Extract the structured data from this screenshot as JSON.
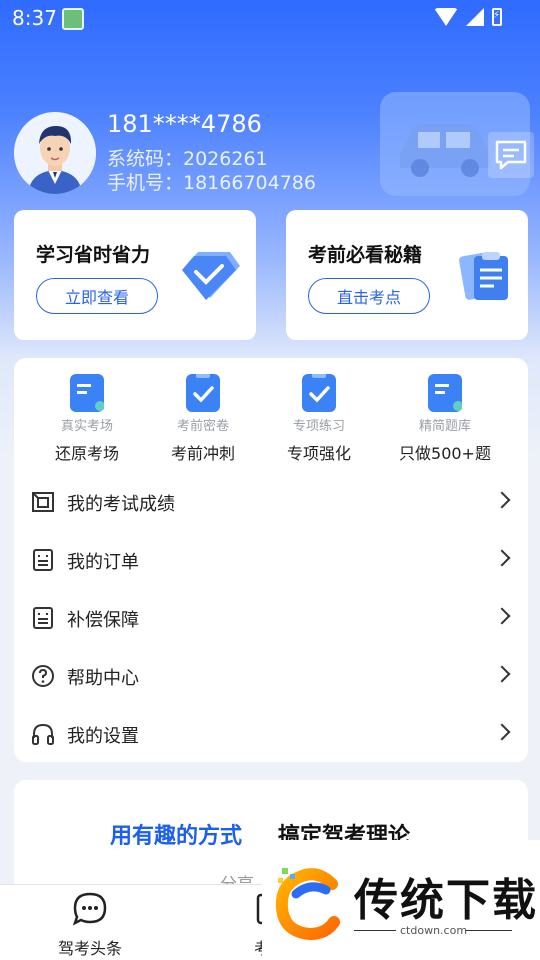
{
  "status": {
    "time": "8:37"
  },
  "profile": {
    "name": "181****4786",
    "system_code": "系统码：2026261",
    "phone": "手机号：18166704786"
  },
  "promo": [
    {
      "title": "学习省时省力",
      "button": "立即查看"
    },
    {
      "title": "考前必看秘籍",
      "button": "直击考点"
    }
  ],
  "features": [
    {
      "sub": "真实考场",
      "label": "还原考场",
      "icon": "doc-icon"
    },
    {
      "sub": "考前密卷",
      "label": "考前冲刺",
      "icon": "clipboard-check-icon"
    },
    {
      "sub": "专项练习",
      "label": "专项强化",
      "icon": "clipboard-check-icon"
    },
    {
      "sub": "精简题库",
      "label": "只做500+题",
      "icon": "doc-icon"
    }
  ],
  "menu": [
    {
      "label": "我的考试成绩",
      "icon": "score-icon"
    },
    {
      "label": "我的订单",
      "icon": "order-icon"
    },
    {
      "label": "补偿保障",
      "icon": "guarantee-icon"
    },
    {
      "label": "帮助中心",
      "icon": "help-icon"
    },
    {
      "label": "我的设置",
      "icon": "headset-icon"
    }
  ],
  "bottom_card": {
    "slogan_highlight": "用有趣的方式",
    "slogan_rest": "搞定驾考理论",
    "partial_text": "分享"
  },
  "tabs": [
    {
      "label": "驾考头条",
      "icon": "chat-bubble-icon"
    },
    {
      "label": "考试",
      "icon": "exam-icon"
    }
  ],
  "watermark": {
    "text": "传统下载",
    "url": "ctdown.com"
  },
  "colors": {
    "accent": "#2a63e8",
    "header": "#2f6bff"
  }
}
